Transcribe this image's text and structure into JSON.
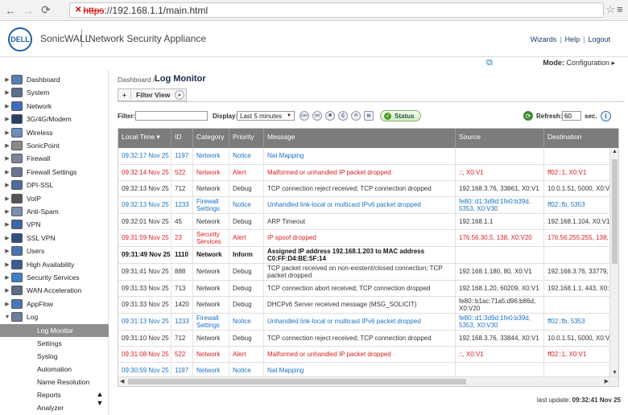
{
  "browser": {
    "url_warn": "✕",
    "url_protocol": "https",
    "url_rest": "://192.168.1.1/main.html"
  },
  "header": {
    "logo_text": "DELL",
    "brand": "SonicWALL",
    "product": "Network Security Appliance",
    "links": [
      "Wizards",
      "Help",
      "Logout"
    ]
  },
  "mode": {
    "label": "Mode:",
    "value": "Configuration ▸"
  },
  "sidebar": {
    "items": [
      {
        "label": "Dashboard",
        "icon": "dashboard-icon",
        "color": "#5a7fb0"
      },
      {
        "label": "System",
        "icon": "system-icon",
        "color": "#5c6f8a"
      },
      {
        "label": "Network",
        "icon": "network-icon",
        "color": "#3a6ebd"
      },
      {
        "label": "3G/4G/Modem",
        "icon": "modem-icon",
        "color": "#2c3e63"
      },
      {
        "label": "Wireless",
        "icon": "wireless-icon",
        "color": "#6a8fc0"
      },
      {
        "label": "SonicPoint",
        "icon": "sonicpoint-icon",
        "color": "#8a8a8a"
      },
      {
        "label": "Firewall",
        "icon": "firewall-icon",
        "color": "#7a8598"
      },
      {
        "label": "Firewall Settings",
        "icon": "firewall-settings-icon",
        "color": "#6a7690"
      },
      {
        "label": "DPI-SSL",
        "icon": "dpi-ssl-icon",
        "color": "#4b6e9c"
      },
      {
        "label": "VoIP",
        "icon": "voip-icon",
        "color": "#555"
      },
      {
        "label": "Anti-Spam",
        "icon": "anti-spam-icon",
        "color": "#7b8fb0"
      },
      {
        "label": "VPN",
        "icon": "vpn-icon",
        "color": "#3d66a3"
      },
      {
        "label": "SSL VPN",
        "icon": "ssl-vpn-icon",
        "color": "#2f4f80"
      },
      {
        "label": "Users",
        "icon": "users-icon",
        "color": "#4a72ad"
      },
      {
        "label": "High Availability",
        "icon": "high-availability-icon",
        "color": "#3a5e93"
      },
      {
        "label": "Security Services",
        "icon": "security-services-icon",
        "color": "#3b82c4"
      },
      {
        "label": "WAN Acceleration",
        "icon": "wan-acceleration-icon",
        "color": "#5b6c85"
      },
      {
        "label": "AppFlow",
        "icon": "appflow-icon",
        "color": "#4a78b5"
      },
      {
        "label": "Log",
        "icon": "log-icon",
        "color": "#6c7f9e"
      }
    ],
    "log_subitems": [
      "Log Monitor",
      "Settings",
      "Syslog",
      "Automation",
      "Name Resolution",
      "Reports",
      "Analyzer"
    ],
    "active_subitem": "Log Monitor"
  },
  "main": {
    "breadcrumb": "Dashboard /",
    "title": "Log Monitor",
    "filter_view": "Filter View"
  },
  "toolbar": {
    "filter_label": "Filter:",
    "filter_value": "",
    "display_label": "Display:",
    "display_value": "Last 5 minutes",
    "icons": [
      "csv",
      "txt"
    ],
    "status_label": "Status",
    "refresh_label": "Refresh:",
    "refresh_value": "60",
    "refresh_unit": "sec."
  },
  "table": {
    "columns": [
      "Local Time",
      "ID",
      "Category",
      "Priority",
      "Message",
      "Source",
      "Destination"
    ],
    "rows": [
      {
        "time": "09:32:17 Nov 25",
        "id": "1197",
        "category": "Network",
        "priority": "Notice",
        "message": "Nat Mapping",
        "source": "",
        "destination": ""
      },
      {
        "time": "09:32:14 Nov 25",
        "id": "522",
        "category": "Network",
        "priority": "Alert",
        "message": "Malformed or unhandled IP packet dropped",
        "source": "::, X0:V1",
        "destination": "ff02::1, X0:V1"
      },
      {
        "time": "09:32:13 Nov 25",
        "id": "712",
        "category": "Network",
        "priority": "Debug",
        "message": "TCP connection reject received; TCP connection dropped",
        "source": "192.168.3.76, 33861, X0:V1",
        "destination": "10.0.1.51, 5000, X0:V"
      },
      {
        "time": "09:32:13 Nov 25",
        "id": "1233",
        "category": "Firewall Settings",
        "priority": "Notice",
        "message": "Unhandled link-local or multicast IPv6 packet dropped",
        "source": "fe80::d1:3d9d:1fe0:b39d, 5353, X0:V30",
        "destination": "ff02::fb, 5353"
      },
      {
        "time": "09:32:01 Nov 25",
        "id": "45",
        "category": "Network",
        "priority": "Debug",
        "message": "ARP Timeout",
        "source": "192.168.1.1",
        "destination": "192.168.1.104, X0:V1"
      },
      {
        "time": "09:31:59 Nov 25",
        "id": "23",
        "category": "Security Services",
        "priority": "Alert",
        "message": "IP spoof dropped",
        "source": "176.56.30.5, 138, X0:V20",
        "destination": "176.56.255.255, 138,"
      },
      {
        "time": "09:31:49 Nov 25",
        "id": "1110",
        "category": "Network",
        "priority": "Inform",
        "message": "Assigned IP address 192.168.1.203 to MAC address C0:FF:D4:BE:5F:14",
        "source": "",
        "destination": ""
      },
      {
        "time": "09:31:41 Nov 25",
        "id": "888",
        "category": "Network",
        "priority": "Debug",
        "message": "TCP packet received on non-existent/closed connection; TCP packet dropped",
        "source": "192.168.1.180, 80, X0:V1",
        "destination": "192.168.3.76, 33779,"
      },
      {
        "time": "09:31:33 Nov 25",
        "id": "713",
        "category": "Network",
        "priority": "Debug",
        "message": "TCP connection abort received; TCP connection dropped",
        "source": "192.168.1.20, 60209, X0:V1",
        "destination": "192.168.1.1, 443, X0:"
      },
      {
        "time": "09:31:33 Nov 25",
        "id": "1420",
        "category": "Network",
        "priority": "Debug",
        "message": "DHCPv6 Server received message (MSG_SOLICIT)",
        "source": "fe80::b1ac:71a5:d96:b86d, X0:V20",
        "destination": ""
      },
      {
        "time": "09:31:13 Nov 25",
        "id": "1233",
        "category": "Firewall Settings",
        "priority": "Notice",
        "message": "Unhandled link-local or multicast IPv6 packet dropped",
        "source": "fe80::d1:3d9d:1fe0:b39d, 5353, X0:V30",
        "destination": "ff02::fb, 5353"
      },
      {
        "time": "09:31:10 Nov 25",
        "id": "712",
        "category": "Network",
        "priority": "Debug",
        "message": "TCP connection reject received; TCP connection dropped",
        "source": "192.168.3.76, 33844, X0:V1",
        "destination": "10.0.1.51, 5000, X0:V"
      },
      {
        "time": "09:31:08 Nov 25",
        "id": "522",
        "category": "Network",
        "priority": "Alert",
        "message": "Malformed or unhandled IP packet dropped",
        "source": "::, X0:V1",
        "destination": "ff02::1, X0:V1"
      },
      {
        "time": "09:30:59 Nov 25",
        "id": "1197",
        "category": "Network",
        "priority": "Notice",
        "message": "Nat Mapping",
        "source": "",
        "destination": ""
      }
    ]
  },
  "footer": {
    "last_update_label": "last update:",
    "last_update_value": "09:32:41 Nov 25"
  },
  "colors": {
    "notice": "#1a73c4",
    "alert": "#d81e1e",
    "debug": "#333333",
    "header_bg": "#7c7c7c",
    "active_side": "#8f8f8f"
  }
}
